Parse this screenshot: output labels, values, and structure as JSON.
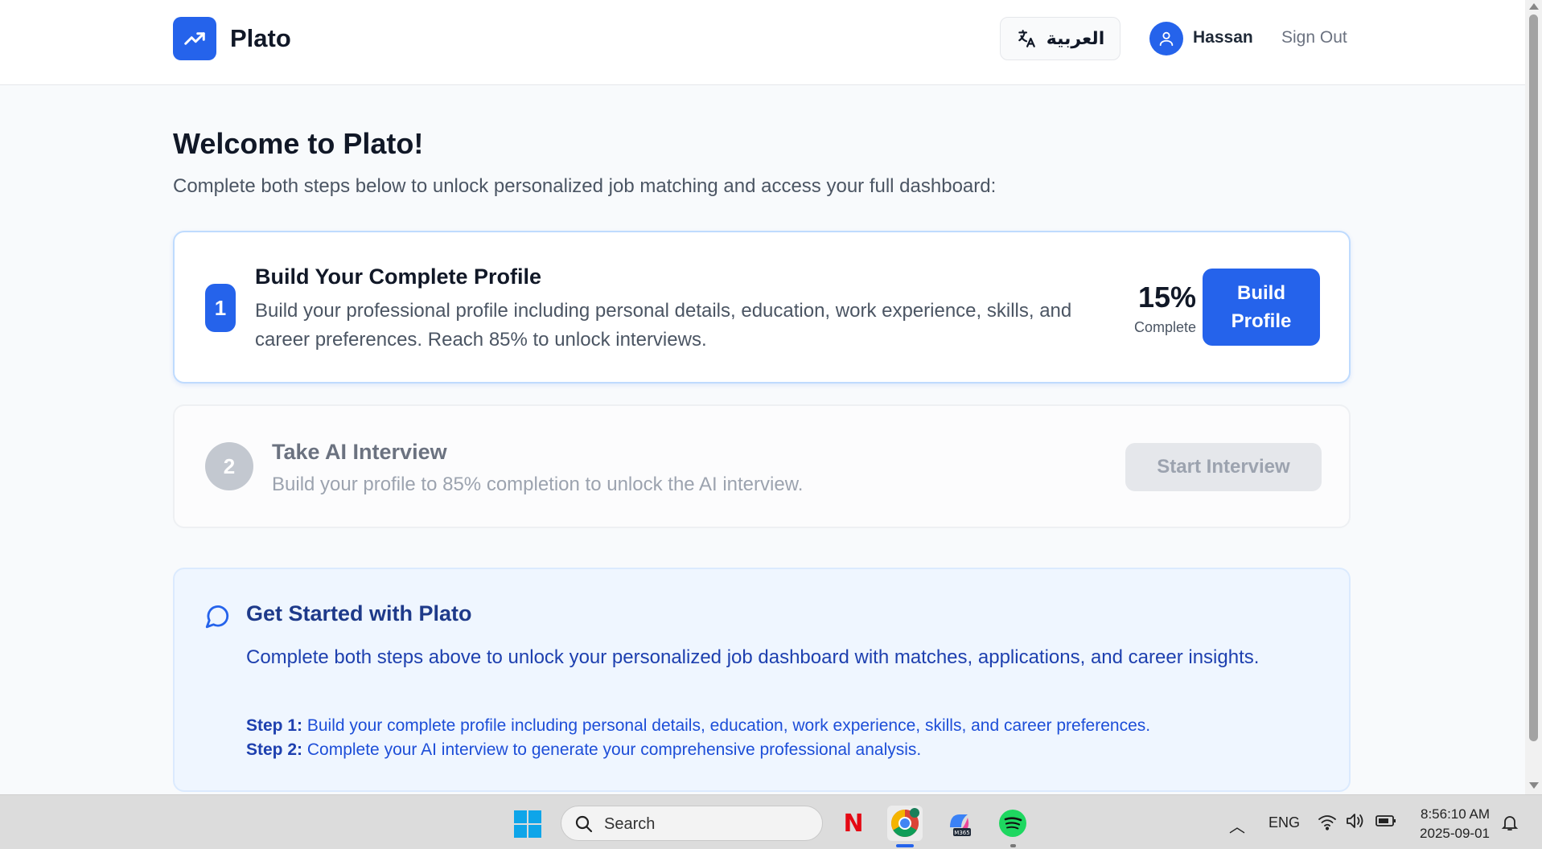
{
  "header": {
    "app_name": "Plato",
    "language_button": "العربية",
    "user_name": "Hassan",
    "sign_out": "Sign Out"
  },
  "main": {
    "title": "Welcome to Plato!",
    "subtitle": "Complete both steps below to unlock personalized job matching and access your full dashboard:",
    "step1": {
      "number": "1",
      "title": "Build Your Complete Profile",
      "description": "Build your professional profile including personal details, education, work experience, skills, and career preferences. Reach 85% to unlock interviews.",
      "progress_text": "15%",
      "progress_value": 15,
      "progress_label": "Complete",
      "button": "Build Profile"
    },
    "step2": {
      "number": "2",
      "title": "Take AI Interview",
      "description": "Build your profile to 85% completion to unlock the AI interview.",
      "button": "Start Interview",
      "disabled": true
    },
    "info": {
      "title": "Get Started with Plato",
      "description": "Complete both steps above to unlock your personalized job dashboard with matches, applications, and career insights.",
      "step1_label": "Step 1:",
      "step1_text": "Build your complete profile including personal details, education, work experience, skills, and career preferences.",
      "step2_label": "Step 2:",
      "step2_text": "Complete your AI interview to generate your comprehensive professional analysis."
    }
  },
  "taskbar": {
    "search_placeholder": "Search",
    "apps": [
      "netflix-icon",
      "chrome-icon",
      "m365-copilot-icon",
      "spotify-icon"
    ],
    "language": "ENG",
    "time": "8:56:10 AM",
    "date": "2025-09-01"
  },
  "colors": {
    "primary": "#2563eb",
    "info_bg": "#eff6ff",
    "disabled": "#e5e7eb"
  }
}
